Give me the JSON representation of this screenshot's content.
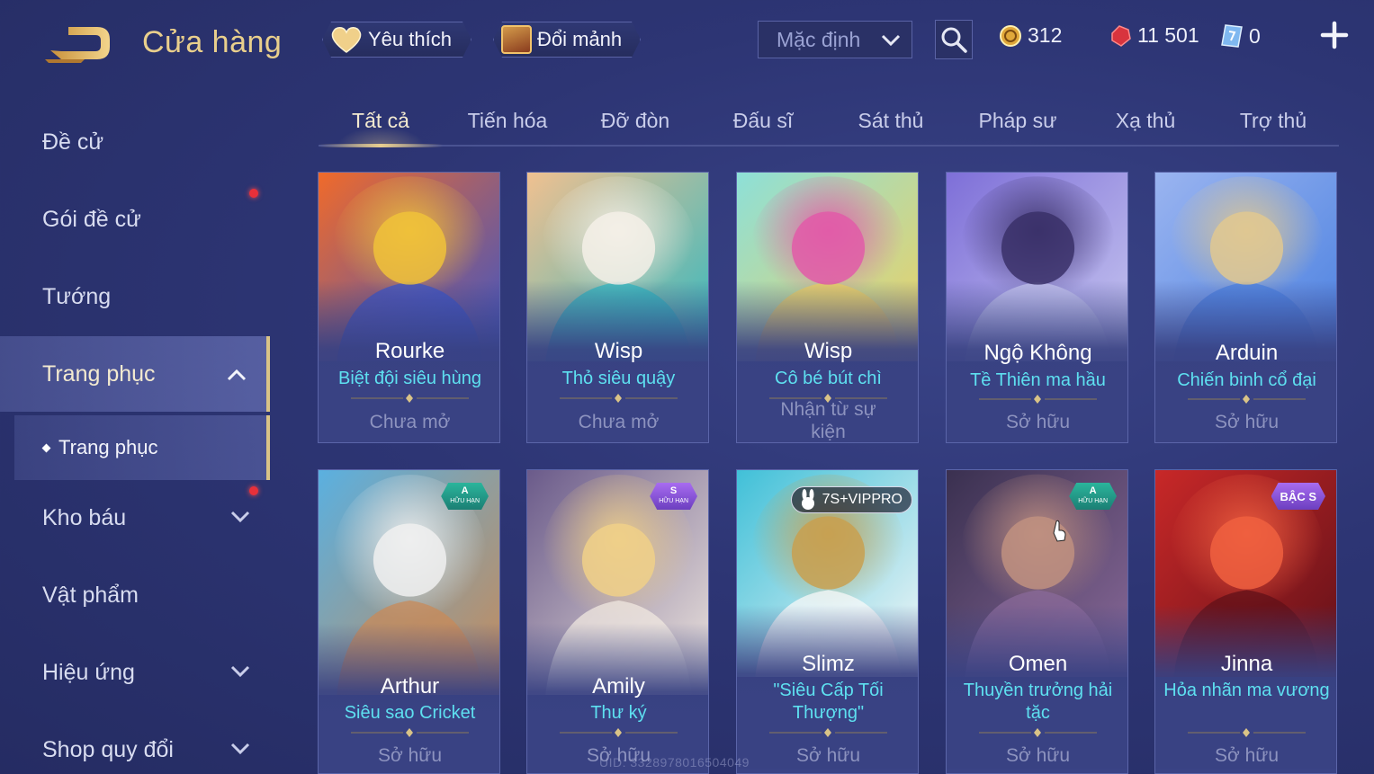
{
  "header": {
    "title": "Cửa hàng",
    "favorites_label": "Yêu thích",
    "exchange_label": "Đổi mảnh",
    "sort": {
      "selected": "Mặc định"
    },
    "currencies": {
      "gold": "312",
      "vouchers": "11 501",
      "tickets": "0"
    }
  },
  "sidebar": {
    "items": [
      {
        "label": "Đề cử"
      },
      {
        "label": "Gói đề cử",
        "has_notification": true
      },
      {
        "label": "Tướng"
      },
      {
        "label": "Trang phục",
        "expanded": true,
        "active": true
      },
      {
        "label": "Kho báu",
        "has_notification": true
      },
      {
        "label": "Vật phẩm"
      },
      {
        "label": "Hiệu ứng"
      },
      {
        "label": "Shop quy đổi"
      }
    ],
    "sub_item": {
      "label": "Trang phục"
    }
  },
  "tabs": [
    {
      "label": "Tất cả",
      "active": true
    },
    {
      "label": "Tiến hóa"
    },
    {
      "label": "Đỡ đòn"
    },
    {
      "label": "Đấu sĩ"
    },
    {
      "label": "Sát thủ"
    },
    {
      "label": "Pháp sư"
    },
    {
      "label": "Xạ thủ"
    },
    {
      "label": "Trợ thủ"
    }
  ],
  "cards": [
    {
      "hero": "Rourke",
      "skin": "Biệt đội siêu hùng",
      "status": "Chưa mở",
      "colors": [
        "#f06a2a",
        "#3a54c8",
        "#f0c23a"
      ]
    },
    {
      "hero": "Wisp",
      "skin": "Thỏ siêu quậy",
      "status": "Chưa mở",
      "colors": [
        "#f0c090",
        "#2fb8c0",
        "#f5f0e8"
      ]
    },
    {
      "hero": "Wisp",
      "skin": "Cô bé bút chì",
      "status": "Nhận từ sự kiện",
      "colors": [
        "#8de0d8",
        "#f0d060",
        "#e25aa8"
      ]
    },
    {
      "hero": "Ngộ Không",
      "skin": "Tề Thiên ma hầu",
      "status": "Sở hữu",
      "colors": [
        "#7e6fd8",
        "#c8c8f0",
        "#3a3068"
      ]
    },
    {
      "hero": "Arduin",
      "skin": "Chiến binh cổ đại",
      "status": "Sở hữu",
      "colors": [
        "#9ab4f0",
        "#4a80e0",
        "#e0c890"
      ]
    },
    {
      "hero": "Arthur",
      "skin": "Siêu sao Cricket",
      "status": "Sở hữu",
      "badge": {
        "tier": "A",
        "label": "HỮU HẠN",
        "color": "#2bb59c"
      },
      "colors": [
        "#5ab0e0",
        "#c88a58",
        "#f0f0f0"
      ]
    },
    {
      "hero": "Amily",
      "skin": "Thư ký",
      "status": "Sở hữu",
      "badge": {
        "tier": "S",
        "label": "HỮU HẠN",
        "color": "#a86cf0"
      },
      "colors": [
        "#6a5a8a",
        "#f0e8e0",
        "#f0d088"
      ]
    },
    {
      "hero": "Slimz",
      "skin": "\"Siêu Cấp Tối Thượng\"",
      "status": "Sở hữu",
      "badge": {
        "tier": "7S+VIPPRO",
        "label": ""
      },
      "colors": [
        "#40c0d8",
        "#f8f8f8",
        "#c8a050"
      ]
    },
    {
      "hero": "Omen",
      "skin": "Thuyền trưởng hải tặc",
      "status": "Sở hữu",
      "badge": {
        "tier": "A",
        "label": "HỮU HẠN",
        "color": "#2bb59c"
      },
      "colors": [
        "#3a3050",
        "#8a6a9a",
        "#c09080"
      ]
    },
    {
      "hero": "Jinna",
      "skin": "Hỏa nhãn ma vương",
      "status": "Sở hữu",
      "badge": {
        "tier": "BẬC S",
        "label": "",
        "color": "#a86cf0"
      },
      "colors": [
        "#c82828",
        "#601018",
        "#f06040"
      ]
    }
  ],
  "footer": {
    "uid": "UID: 3328978016504049"
  }
}
